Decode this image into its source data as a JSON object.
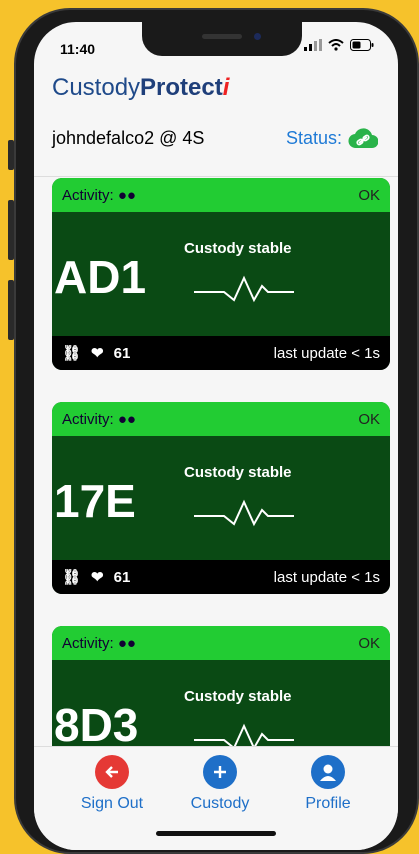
{
  "status_bar": {
    "time": "11:40"
  },
  "app": {
    "brand_part1": "Custody",
    "brand_part2": "Protect",
    "brand_part3": "i"
  },
  "session": {
    "user": "johndefalco2 @ 4S",
    "status_label": "Status:"
  },
  "cards": [
    {
      "activity": "Activity:",
      "ok": "OK",
      "code": "AD1",
      "state": "Custody stable",
      "heart": "61",
      "update": "last update < 1s"
    },
    {
      "activity": "Activity:",
      "ok": "OK",
      "code": "17E",
      "state": "Custody stable",
      "heart": "61",
      "update": "last update < 1s"
    },
    {
      "activity": "Activity:",
      "ok": "OK",
      "code": "8D3",
      "state": "Custody stable",
      "heart": "",
      "update": ""
    }
  ],
  "tabs": {
    "sign_out": "Sign Out",
    "custody": "Custody",
    "profile": "Profile"
  },
  "colors": {
    "accent": "#1e6fc8",
    "card_green": "#22cc33",
    "card_dark": "#0a4a14",
    "sign_out": "#e53935",
    "background": "#f6c22b"
  },
  "icons": [
    "link-icon",
    "heart-icon",
    "cloud-link-icon",
    "arrow-left-icon",
    "plus-icon",
    "person-icon"
  ]
}
